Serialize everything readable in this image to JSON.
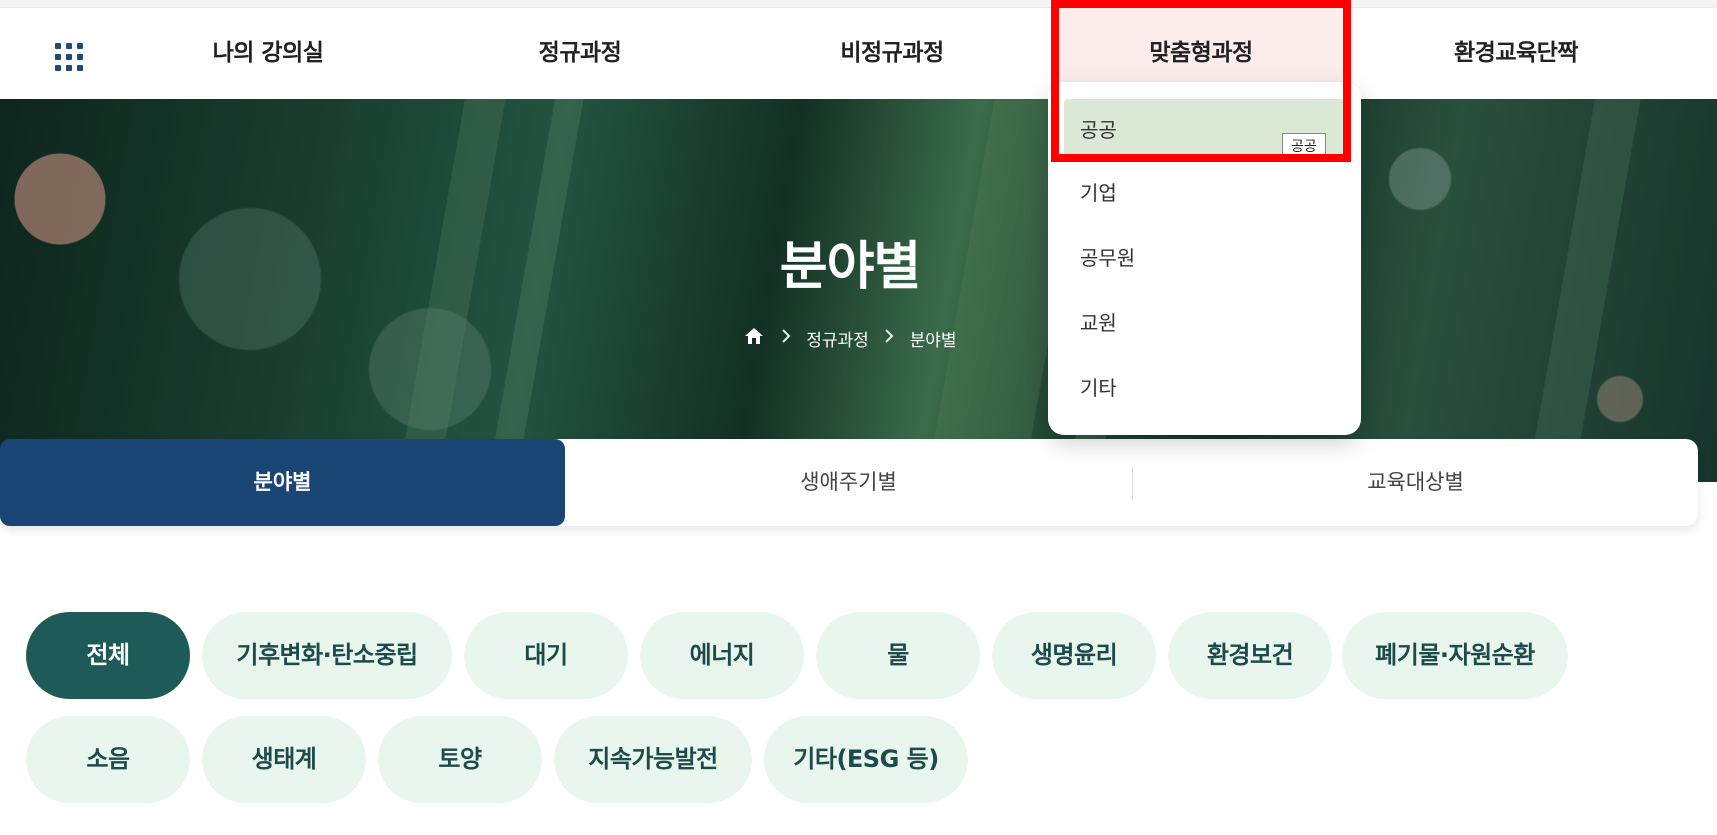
{
  "nav": {
    "items": [
      "나의 강의실",
      "정규과정",
      "비정규과정",
      "맞춤형과정",
      "환경교육단짝"
    ]
  },
  "dropdown": {
    "items": [
      "공공",
      "기업",
      "공무원",
      "교원",
      "기타"
    ],
    "tooltip": "공공"
  },
  "hero": {
    "title": "분야별",
    "breadcrumb": [
      "정규과정",
      "분야별"
    ]
  },
  "tabs": [
    "분야별",
    "생애주기별",
    "교육대상별"
  ],
  "chips": [
    "전체",
    "기후변화·탄소중립",
    "대기",
    "에너지",
    "물",
    "생명윤리",
    "환경보건",
    "폐기물·자원순환",
    "소음",
    "생태계",
    "토양",
    "지속가능발전",
    "기타(ESG 등)"
  ],
  "colors": {
    "nav_active_bg": "#fdecec",
    "tab_active": "#1a4676",
    "chip_active": "#1e5a57",
    "chip_bg": "#e9f6ee",
    "dropdown_hover": "#dce8d6",
    "annotation_box": "#ff0000"
  },
  "icons": [
    "grid-menu-icon",
    "home-icon",
    "chevron-right-icon"
  ]
}
